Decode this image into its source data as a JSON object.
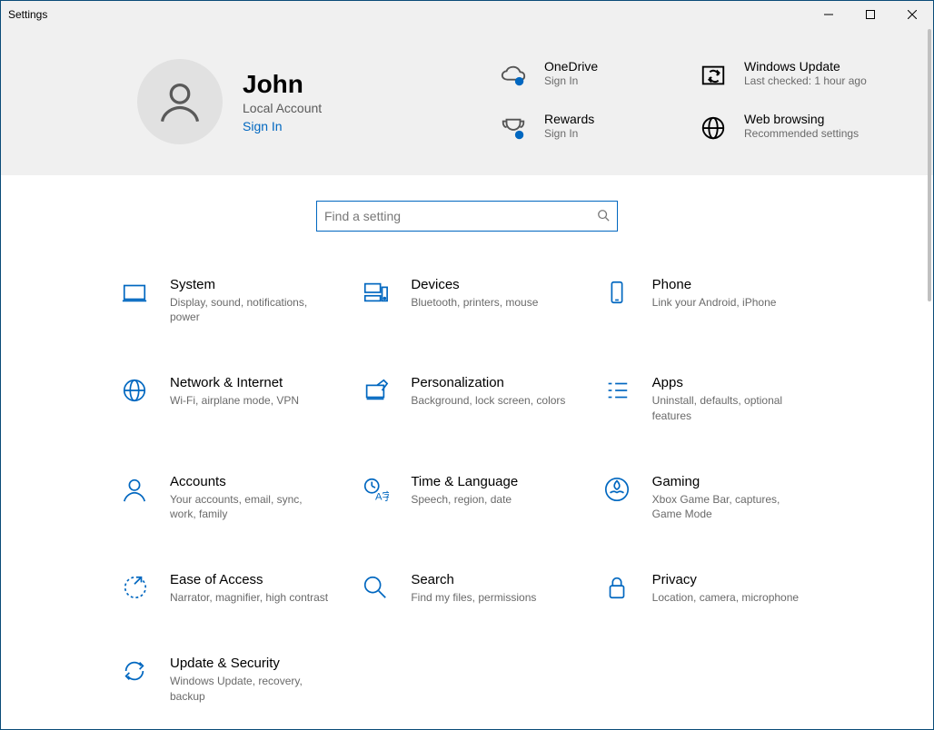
{
  "window": {
    "title": "Settings"
  },
  "profile": {
    "name": "John",
    "account_type": "Local Account",
    "signin_label": "Sign In"
  },
  "tiles": {
    "onedrive": {
      "title": "OneDrive",
      "subtitle": "Sign In"
    },
    "windows_update": {
      "title": "Windows Update",
      "subtitle": "Last checked: 1 hour ago"
    },
    "rewards": {
      "title": "Rewards",
      "subtitle": "Sign In"
    },
    "web_browsing": {
      "title": "Web browsing",
      "subtitle": "Recommended settings"
    }
  },
  "search": {
    "placeholder": "Find a setting"
  },
  "categories": {
    "system": {
      "title": "System",
      "subtitle": "Display, sound, notifications, power"
    },
    "devices": {
      "title": "Devices",
      "subtitle": "Bluetooth, printers, mouse"
    },
    "phone": {
      "title": "Phone",
      "subtitle": "Link your Android, iPhone"
    },
    "network": {
      "title": "Network & Internet",
      "subtitle": "Wi-Fi, airplane mode, VPN"
    },
    "personalization": {
      "title": "Personalization",
      "subtitle": "Background, lock screen, colors"
    },
    "apps": {
      "title": "Apps",
      "subtitle": "Uninstall, defaults, optional features"
    },
    "accounts": {
      "title": "Accounts",
      "subtitle": "Your accounts, email, sync, work, family"
    },
    "time_language": {
      "title": "Time & Language",
      "subtitle": "Speech, region, date"
    },
    "gaming": {
      "title": "Gaming",
      "subtitle": "Xbox Game Bar, captures, Game Mode"
    },
    "ease_of_access": {
      "title": "Ease of Access",
      "subtitle": "Narrator, magnifier, high contrast"
    },
    "search": {
      "title": "Search",
      "subtitle": "Find my files, permissions"
    },
    "privacy": {
      "title": "Privacy",
      "subtitle": "Location, camera, microphone"
    },
    "update_security": {
      "title": "Update & Security",
      "subtitle": "Windows Update, recovery, backup"
    }
  }
}
